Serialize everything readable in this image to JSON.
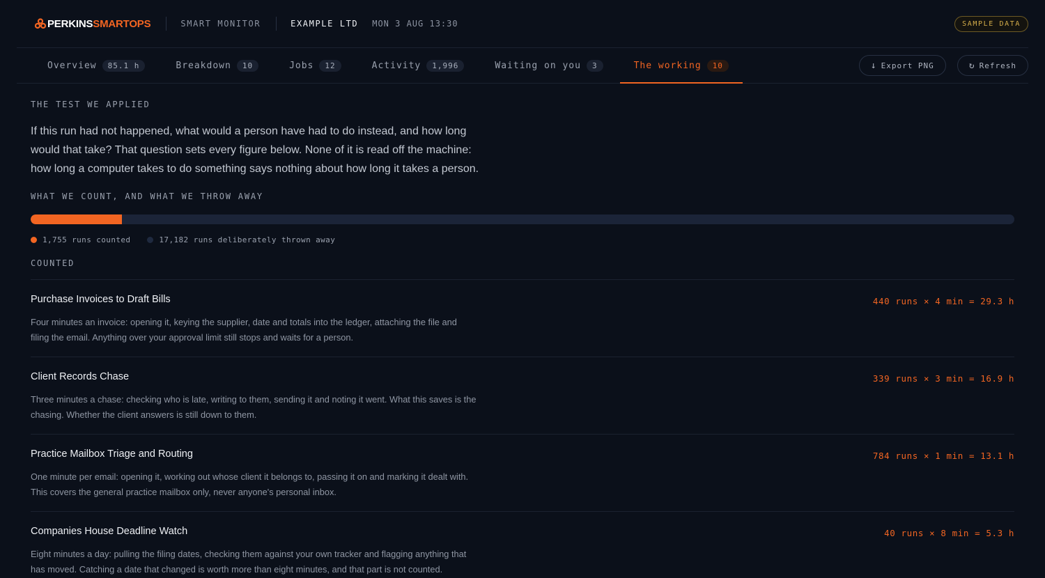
{
  "header": {
    "brand_part1": "PERKINS",
    "brand_part2": "SMARTOPS",
    "product": "SMART MONITOR",
    "company": "EXAMPLE LTD",
    "datetime": "MON 3 AUG 13:30",
    "badge": "SAMPLE DATA"
  },
  "tabs": [
    {
      "label": "Overview",
      "count": "85.1 h",
      "active": false
    },
    {
      "label": "Breakdown",
      "count": "10",
      "active": false
    },
    {
      "label": "Jobs",
      "count": "12",
      "active": false
    },
    {
      "label": "Activity",
      "count": "1,996",
      "active": false
    },
    {
      "label": "Waiting on you",
      "count": "3",
      "active": false
    },
    {
      "label": "The working",
      "count": "10",
      "active": true
    }
  ],
  "actions": {
    "export_label": "Export PNG",
    "export_icon": "download-arrow-icon",
    "refresh_label": "Refresh",
    "refresh_icon": "refresh-icon"
  },
  "test": {
    "label": "THE TEST WE APPLIED",
    "text": "If this run had not happened, what would a person have had to do instead, and how long would that take? That question sets every figure below. None of it is read off the machine: how long a computer takes to do something says nothing about how long it takes a person."
  },
  "count": {
    "label": "WHAT WE COUNT, AND WHAT WE THROW AWAY",
    "counted_runs": 1755,
    "discarded_runs": 17182,
    "counted_text": "1,755 runs counted",
    "discarded_text": "17,182 runs deliberately thrown away",
    "counted_color": "#f26522",
    "discarded_color": "#1b2438"
  },
  "counted": {
    "label": "COUNTED",
    "items": [
      {
        "title": "Purchase Invoices to Draft Bills",
        "calc": "440 runs × 4 min = 29.3 h",
        "desc": "Four minutes an invoice: opening it, keying the supplier, date and totals into the ledger, attaching the file and filing the email. Anything over your approval limit still stops and waits for a person."
      },
      {
        "title": "Client Records Chase",
        "calc": "339 runs × 3 min = 16.9 h",
        "desc": "Three minutes a chase: checking who is late, writing to them, sending it and noting it went. What this saves is the chasing. Whether the client answers is still down to them."
      },
      {
        "title": "Practice Mailbox Triage and Routing",
        "calc": "784 runs × 1 min = 13.1 h",
        "desc": "One minute per email: opening it, working out whose client it belongs to, passing it on and marking it dealt with. This covers the general practice mailbox only, never anyone's personal inbox."
      },
      {
        "title": "Companies House Deadline Watch",
        "calc": "40 runs × 8 min = 5.3 h",
        "desc": "Eight minutes a day: pulling the filing dates, checking them against your own tracker and flagging anything that has moved. Catching a date that changed is worth more than eight minutes, and that part is not counted."
      }
    ]
  }
}
